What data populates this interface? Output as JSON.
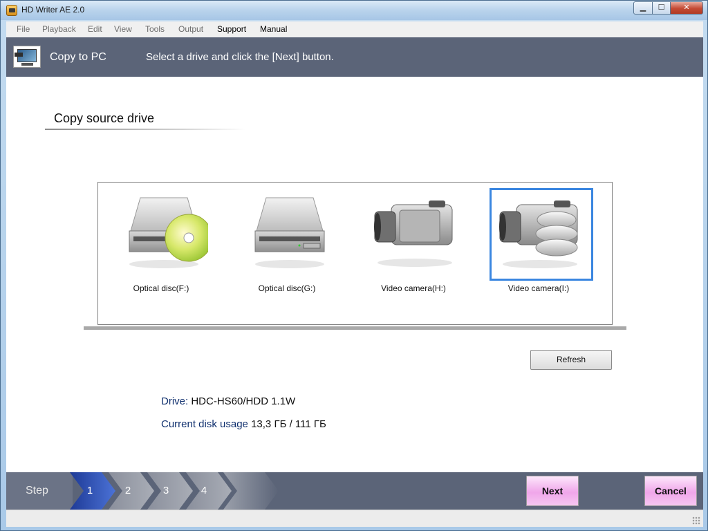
{
  "window": {
    "title": "HD Writer AE 2.0",
    "controls": {
      "minimize": "▁",
      "maximize": "☐",
      "close": "✕"
    }
  },
  "menu": [
    {
      "label": "File",
      "active": false
    },
    {
      "label": "Playback",
      "active": false
    },
    {
      "label": "Edit",
      "active": false
    },
    {
      "label": "View",
      "active": false
    },
    {
      "label": "Tools",
      "active": false
    },
    {
      "label": "Output",
      "active": false
    },
    {
      "label": "Support",
      "active": true
    },
    {
      "label": "Manual",
      "active": true
    }
  ],
  "header": {
    "title": "Copy to PC",
    "instruction": "Select a drive and click the [Next] button."
  },
  "section": {
    "title": "Copy source drive"
  },
  "drives": [
    {
      "label": "Optical disc(F:)",
      "icon": "optical-drive-with-disc-icon",
      "selected": false
    },
    {
      "label": "Optical disc(G:)",
      "icon": "optical-drive-icon",
      "selected": false
    },
    {
      "label": "Video camera(H:)",
      "icon": "video-camera-icon",
      "selected": false
    },
    {
      "label": "Video camera(I:)",
      "icon": "video-camera-with-discs-icon",
      "selected": true
    }
  ],
  "refresh_label": "Refresh",
  "info": {
    "drive_label": "Drive:",
    "drive_value": "HDC-HS60/HDD 1.1W",
    "usage_label": "Current disk usage",
    "usage_value": "13,3 ГБ / 111 ГБ"
  },
  "footer": {
    "step_label": "Step",
    "steps": [
      "1",
      "2",
      "3",
      "4"
    ],
    "current_step": "1",
    "next_label": "Next",
    "cancel_label": "Cancel"
  },
  "colors": {
    "header_bg": "#5b6478",
    "step_active": "#2f4fae",
    "selection": "#3a86e0",
    "action_button": "#f0a6ea"
  }
}
